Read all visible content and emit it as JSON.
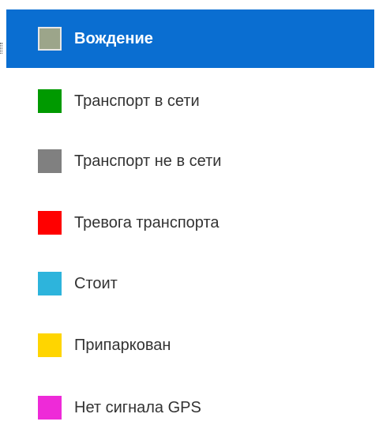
{
  "status_legend": {
    "items": [
      {
        "label": "Вождение",
        "color": "#9ca58a",
        "selected": true
      },
      {
        "label": "Транспорт в сети",
        "color": "#009a00",
        "selected": false
      },
      {
        "label": "Транспорт не в сети",
        "color": "#808080",
        "selected": false
      },
      {
        "label": "Тревога транспорта",
        "color": "#ff0000",
        "selected": false
      },
      {
        "label": "Стоит",
        "color": "#2db4dc",
        "selected": false
      },
      {
        "label": "Припаркован",
        "color": "#ffd500",
        "selected": false
      },
      {
        "label": "Нет сигнала GPS",
        "color": "#ee2ad8",
        "selected": false
      }
    ]
  }
}
